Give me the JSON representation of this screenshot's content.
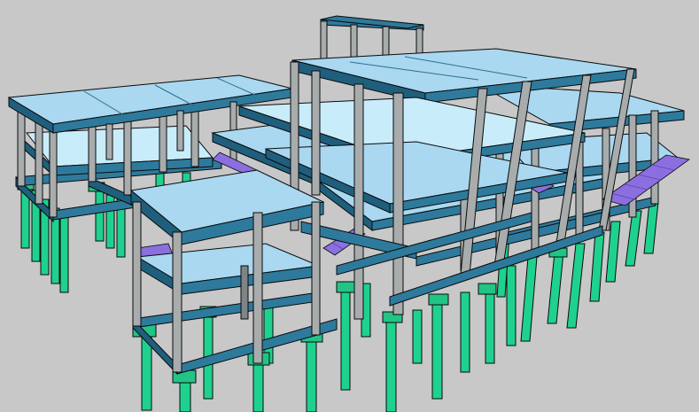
{
  "view": {
    "type": "structural-3d-model",
    "background_color": "#c8c8c8",
    "colors": {
      "slab": "#a9d8f0",
      "slab_light": "#c9ecfb",
      "slab_edge": "#2f6f92",
      "beam": "#2e7a9c",
      "beam_dark": "#1f5f7d",
      "column": "#a8acad",
      "column_dark": "#7f8487",
      "pile": "#1fd18f",
      "pile_dark": "#13a06c",
      "pile_cap": "#22c486",
      "stair": "#8b6fe0",
      "outline": "#0a0a0a"
    },
    "elements": [
      "floor-slabs",
      "beams",
      "columns",
      "piles",
      "pile-caps",
      "stairs",
      "rooftop-frame"
    ]
  }
}
